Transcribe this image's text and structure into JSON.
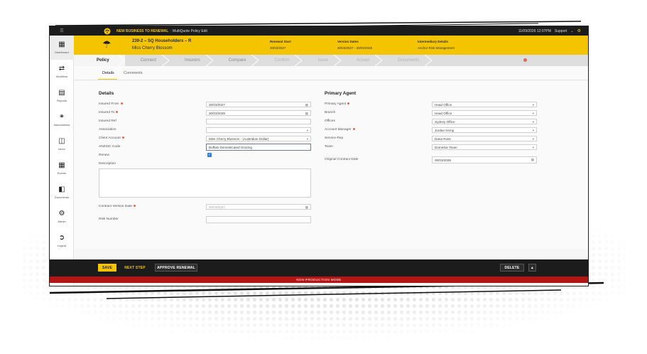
{
  "topbar": {
    "banner": "NEW BUSINESS TO RENEWAL",
    "banner_sub": ": MultiQuote Policy Edit",
    "datetime": "11/09/2026 12:07PM",
    "support_label": "Support"
  },
  "sidebar": {
    "items": [
      {
        "label": "Dashboard",
        "icon": "dashboard-icon"
      },
      {
        "label": "Workflow",
        "icon": "shuffle-icon"
      },
      {
        "label": "Reports",
        "icon": "book-icon"
      },
      {
        "label": "Associations",
        "icon": "link-icon"
      },
      {
        "label": "Inbox",
        "icon": "inbox-icon"
      },
      {
        "label": "Events",
        "icon": "calendar-icon"
      },
      {
        "label": "Documents",
        "icon": "folder-icon"
      },
      {
        "label": "Admin",
        "icon": "gear-icon"
      },
      {
        "label": "Logout",
        "icon": "logout-icon"
      }
    ]
  },
  "header": {
    "policy_title": "239-2 – SQ Householders – R",
    "policy_client": "Miss Cherry Blossom",
    "renewal": {
      "label": "Renewal Start",
      "value": "30/03/2027"
    },
    "version": {
      "label": "Version Dates",
      "value": "30/03/2027 - 30/03/2028"
    },
    "intermediary": {
      "label": "Intermediary Details",
      "value": "Anchor Risk Management"
    }
  },
  "steps": [
    {
      "label": "Policy",
      "state": "active"
    },
    {
      "label": "Connect",
      "state": "enabled"
    },
    {
      "label": "Insurers",
      "state": "enabled"
    },
    {
      "label": "Compare",
      "state": "enabled"
    },
    {
      "label": "Confirm",
      "state": "disabled"
    },
    {
      "label": "Issue",
      "state": "disabled"
    },
    {
      "label": "Accept",
      "state": "disabled"
    },
    {
      "label": "Documents",
      "state": "disabled"
    }
  ],
  "tabs": [
    {
      "label": "Details"
    },
    {
      "label": "Comments"
    }
  ],
  "details": {
    "title": "Details",
    "insured_from_label": "Insured From",
    "insured_from_value": "30/03/2027",
    "insured_to_label": "Insured To",
    "insured_to_value": "30/03/2028",
    "insured_ref_label": "Insured Ref",
    "insured_ref_value": "",
    "association_label": "Association",
    "association_value": "",
    "client_account_label": "Client Account",
    "client_account_value": "Miss Cherry Blossom - (Australian Dollar)",
    "anzsic_label": "ANZSIC Code",
    "anzsic_value": "Buffalo Domesticated Grazing",
    "renew_label": "Renew",
    "renew_checked": true,
    "description_label": "Description",
    "contract_version_label": "Contract Version Date",
    "contract_version_value": "30/03/2027",
    "risk_number_label": "Risk Number",
    "risk_number_value": ""
  },
  "primary_agent": {
    "title": "Primary Agent",
    "primary_agent_label": "Primary Agent",
    "primary_agent_value": "Head Office",
    "branch_label": "Branch",
    "branch_value": "Head Office",
    "office_label": "Offices",
    "office_value": "Sydney Office",
    "account_manager_label": "Account Manager",
    "account_manager_value": "Jordan Kemp",
    "service_rep_label": "Service Rep",
    "service_rep_value": "Dana Ross",
    "team_label": "Team",
    "team_value": "Domestic Team",
    "original_contract_label": "Original Contract Date",
    "original_contract_value": "30/03/2026"
  },
  "actions": {
    "save": "SAVE",
    "next_step": "NEXT STEP",
    "approve_renewal": "APPROVE RENEWAL",
    "delete": "DELETE"
  },
  "nonprod": "NON-PRODUCTION MODE",
  "colors": {
    "brand_yellow": "#f5c400",
    "dark": "#1c1c1c",
    "required_dot": "#e36a4f",
    "nonprod_red": "#b31414",
    "checkbox_blue": "#2f7de1"
  }
}
